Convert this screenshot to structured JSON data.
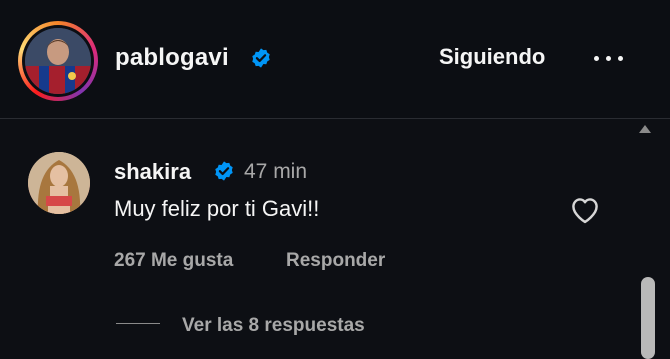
{
  "post_header": {
    "username": "pablogavi",
    "follow_label": "Siguiendo",
    "more_icon": "more-horizontal-icon"
  },
  "comment": {
    "author": "shakira",
    "time": "47 min",
    "text": "Muy feliz por ti Gavi!!",
    "likes": "267 Me gusta",
    "reply_label": "Responder",
    "view_replies_label": "Ver las 8 respuestas"
  },
  "colors": {
    "background": "#0d0f14",
    "verified_blue": "#0095f6",
    "secondary_text": "#a8a8a8"
  }
}
